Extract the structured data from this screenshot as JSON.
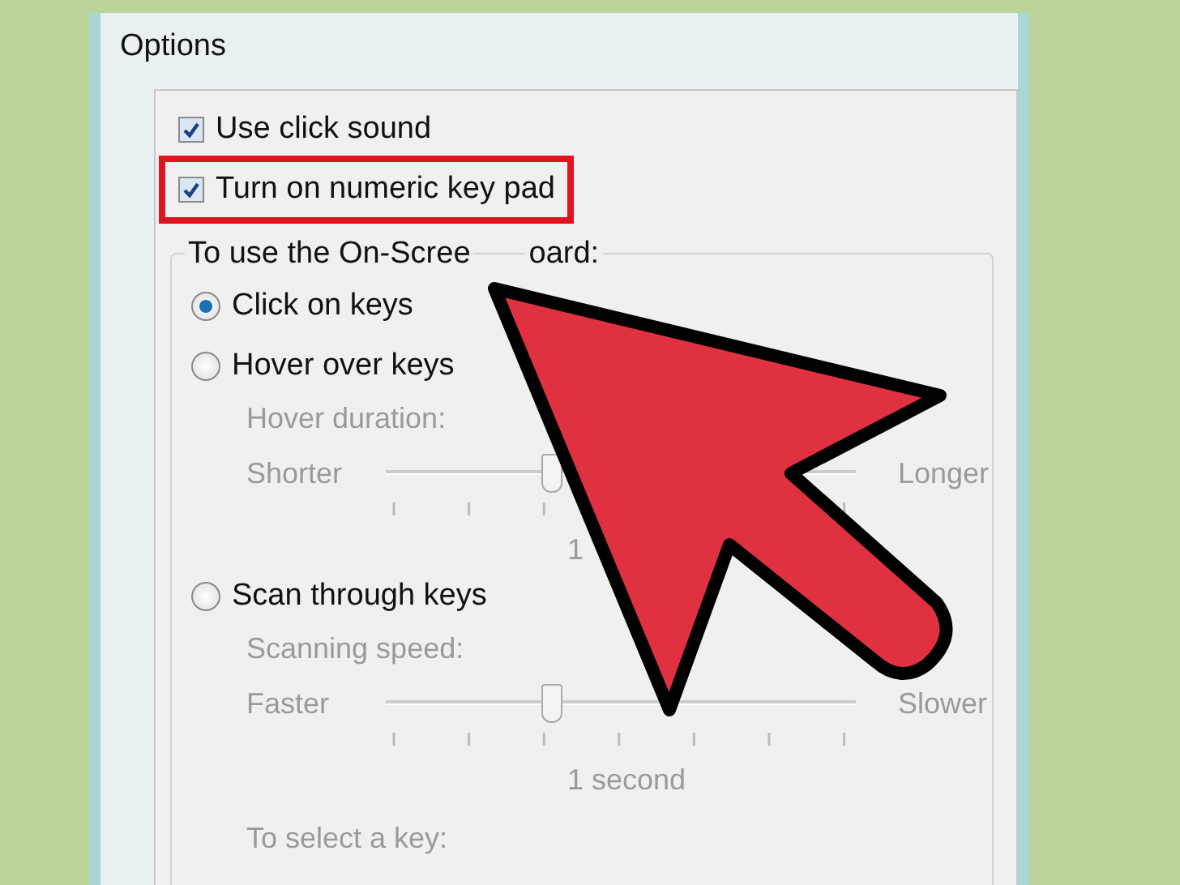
{
  "window": {
    "title": "Options"
  },
  "checkboxes": [
    {
      "label": "Use click sound",
      "checked": true,
      "highlighted": false
    },
    {
      "label": "Turn on numeric key pad",
      "checked": true,
      "highlighted": true
    }
  ],
  "group": {
    "label_parts": [
      "To use the On-Scree",
      "oard:"
    ],
    "modes": [
      {
        "label": "Click on keys",
        "selected": true
      },
      {
        "label": "Hover over keys",
        "selected": false,
        "setting": {
          "caption": "Hover duration:",
          "min_label": "Shorter",
          "max_label": "Longer",
          "level": 0.35,
          "reading": "1",
          "disabled": true
        }
      },
      {
        "label": "Scan through keys",
        "selected": false,
        "setting": {
          "caption": "Scanning speed:",
          "min_label": "Faster",
          "max_label": "Slower",
          "level": 0.35,
          "reading": "1 second",
          "disabled": true
        }
      }
    ],
    "footer_label": "To select a key:"
  }
}
